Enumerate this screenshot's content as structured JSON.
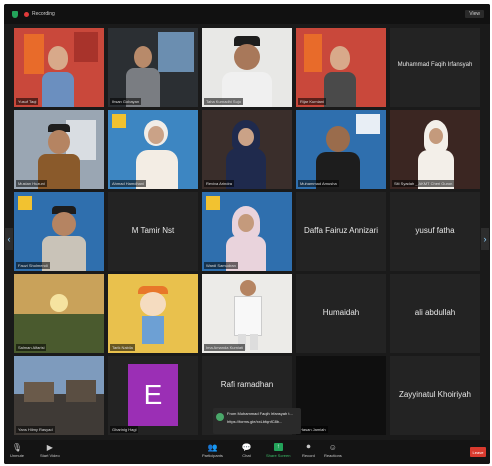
{
  "app": {
    "recording_label": "Recording",
    "view_label": "View"
  },
  "tiles": [
    {
      "name": "Yusuf Taqi",
      "kind": "video"
    },
    {
      "name": "Ihsan Gobayan",
      "kind": "video"
    },
    {
      "name": "Taha Kurnadhi Sujo",
      "kind": "video"
    },
    {
      "name": "Rijar Kurniani",
      "kind": "video"
    },
    {
      "name": "Muhammad Faqih Irfansyah",
      "kind": "name"
    },
    {
      "name": "Mustan Huzuni",
      "kind": "video"
    },
    {
      "name": "Ahmad Hamdhani",
      "kind": "video"
    },
    {
      "name": "Reviva Arindra",
      "kind": "video"
    },
    {
      "name": "Muhammad Amusha",
      "kind": "video"
    },
    {
      "name": "Siti Syadah _ AKMT Cheri Guron",
      "kind": "video"
    },
    {
      "name": "Fauzi Sholmendi",
      "kind": "video"
    },
    {
      "name": "M Tamir Nst",
      "kind": "name"
    },
    {
      "name": "Wardi Samudran",
      "kind": "video"
    },
    {
      "name": "Daffa Fairuz Annizari",
      "kind": "name"
    },
    {
      "name": "yusuf fatha",
      "kind": "name"
    },
    {
      "name": "Salman Alfarisi",
      "kind": "video"
    },
    {
      "name": "Tarik Nabila",
      "kind": "video"
    },
    {
      "name": "Ima Amanda Kurniati",
      "kind": "video"
    },
    {
      "name": "Humaidah",
      "kind": "name"
    },
    {
      "name": "ali abdullah",
      "kind": "name"
    },
    {
      "name": "Yans Hilmy Rasyad",
      "kind": "video"
    },
    {
      "name": "Gharinig Hagi",
      "kind": "initial",
      "initial": "E"
    },
    {
      "name": "Rafi ramadhan",
      "kind": "name"
    },
    {
      "name": "Hasan Jamiah",
      "kind": "dark"
    },
    {
      "name": "Zayyinatul Khoiriyah",
      "kind": "name"
    }
  ],
  "chat_popup": {
    "line1": "From Muhammad Faqih Irfansyah t...",
    "line2": "https://forms.gle/xxLbfqnfC8b..."
  },
  "toolbar": {
    "unmute": "Unmute",
    "start_video": "Start Video",
    "participants": "Participants",
    "chat": "Chat",
    "share_screen": "Share Screen",
    "record": "Record",
    "reactions": "Reactions",
    "leave": "Leave",
    "participants_count": "54"
  },
  "colors": {
    "accent_green": "#23a35a",
    "leave_red": "#d83a2e",
    "active_border": "#d4c43a",
    "initial_tile": "#9b2fb5"
  }
}
